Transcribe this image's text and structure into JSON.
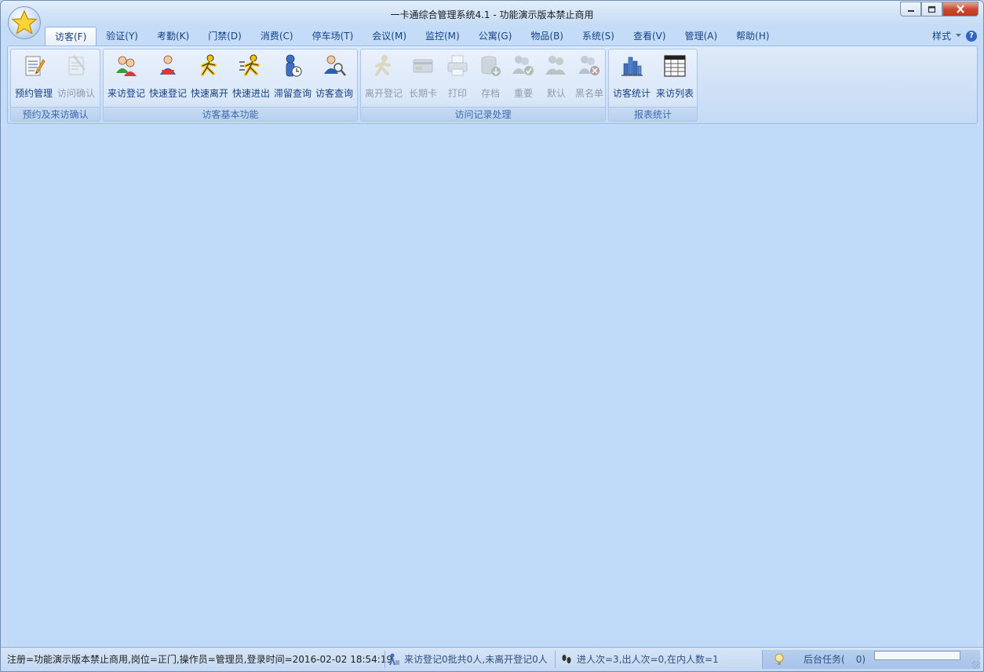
{
  "window": {
    "title": "一卡通综合管理系统4.1 - 功能演示版本禁止商用",
    "controls": [
      "minimize",
      "restore",
      "close"
    ]
  },
  "menu": {
    "tabs": [
      "访客(F)",
      "验证(Y)",
      "考勤(K)",
      "门禁(D)",
      "消费(C)",
      "停车场(T)",
      "会议(M)",
      "监控(M)",
      "公寓(G)",
      "物品(B)",
      "系统(S)",
      "查看(V)",
      "管理(A)",
      "帮助(H)"
    ],
    "active_tab": "访客(F)",
    "style_label": "样式"
  },
  "ribbon": {
    "groups": [
      {
        "label": "预约及来访确认",
        "buttons": [
          {
            "label": "预约管理",
            "icon": "appointment-icon",
            "enabled": true
          },
          {
            "label": "访问确认",
            "icon": "confirm-visit-icon",
            "enabled": false
          }
        ]
      },
      {
        "label": "访客基本功能",
        "buttons": [
          {
            "label": "来访登记",
            "icon": "visitor-register-icon",
            "enabled": true
          },
          {
            "label": "快速登记",
            "icon": "quick-register-icon",
            "enabled": true
          },
          {
            "label": "快速离开",
            "icon": "quick-leave-icon",
            "enabled": true
          },
          {
            "label": "快速进出",
            "icon": "quick-inout-icon",
            "enabled": true
          },
          {
            "label": "滞留查询",
            "icon": "overstay-query-icon",
            "enabled": true
          },
          {
            "label": "访客查询",
            "icon": "visitor-query-icon",
            "enabled": true
          }
        ]
      },
      {
        "label": "访问记录处理",
        "buttons": [
          {
            "label": "离开登记",
            "icon": "leave-register-icon",
            "enabled": false
          },
          {
            "label": "长期卡",
            "icon": "long-term-card-icon",
            "enabled": false
          },
          {
            "label": "打印",
            "icon": "print-icon",
            "enabled": false
          },
          {
            "label": "存档",
            "icon": "archive-icon",
            "enabled": false
          },
          {
            "label": "重要",
            "icon": "important-icon",
            "enabled": false
          },
          {
            "label": "默认",
            "icon": "default-icon",
            "enabled": false
          },
          {
            "label": "黑名单",
            "icon": "blacklist-icon",
            "enabled": false
          }
        ]
      },
      {
        "label": "报表统计",
        "buttons": [
          {
            "label": "访客统计",
            "icon": "statistics-chart-icon",
            "enabled": true
          },
          {
            "label": "来访列表",
            "icon": "visit-list-icon",
            "enabled": true
          }
        ]
      }
    ]
  },
  "statusbar": {
    "session": "注册=功能演示版本禁止商用,岗位=正门,操作员=管理员,登录时间=2016-02-02 18:54:19",
    "visits": "来访登记0批共0人,未离开登记0人",
    "counts": "进人次=3,出人次=0,在内人数=1",
    "tasks_label": "后台任务(",
    "tasks_count": "0)",
    "progress": 0
  },
  "colors": {
    "ribbon_text": "#15428b",
    "workspace": "#bedaf8",
    "close_button": "#c9462c"
  }
}
